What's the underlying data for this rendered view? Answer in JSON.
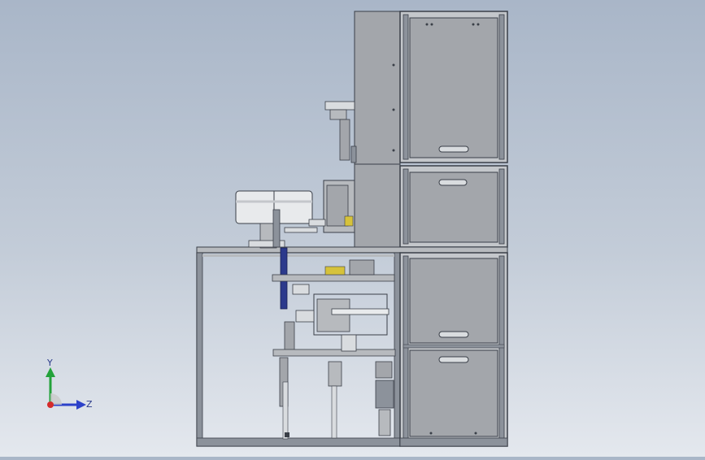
{
  "viewport": {
    "colors": {
      "frame_dark": "#3a3f48",
      "frame_mid": "#8c929b",
      "panel_fill": "#a3a6ab",
      "panel_light": "#b7babe",
      "part_light": "#d9dcdf",
      "cylinder_fill": "#e8eaec",
      "accent_blue": "#2c3a8c",
      "accent_yellow": "#d6c23a"
    }
  },
  "triad": {
    "x_axis_label": "Z",
    "y_axis_label": "Y",
    "colors": {
      "y_axis": "#23a23a",
      "z_axis": "#2c41c9",
      "origin": "#d42b2b"
    }
  }
}
